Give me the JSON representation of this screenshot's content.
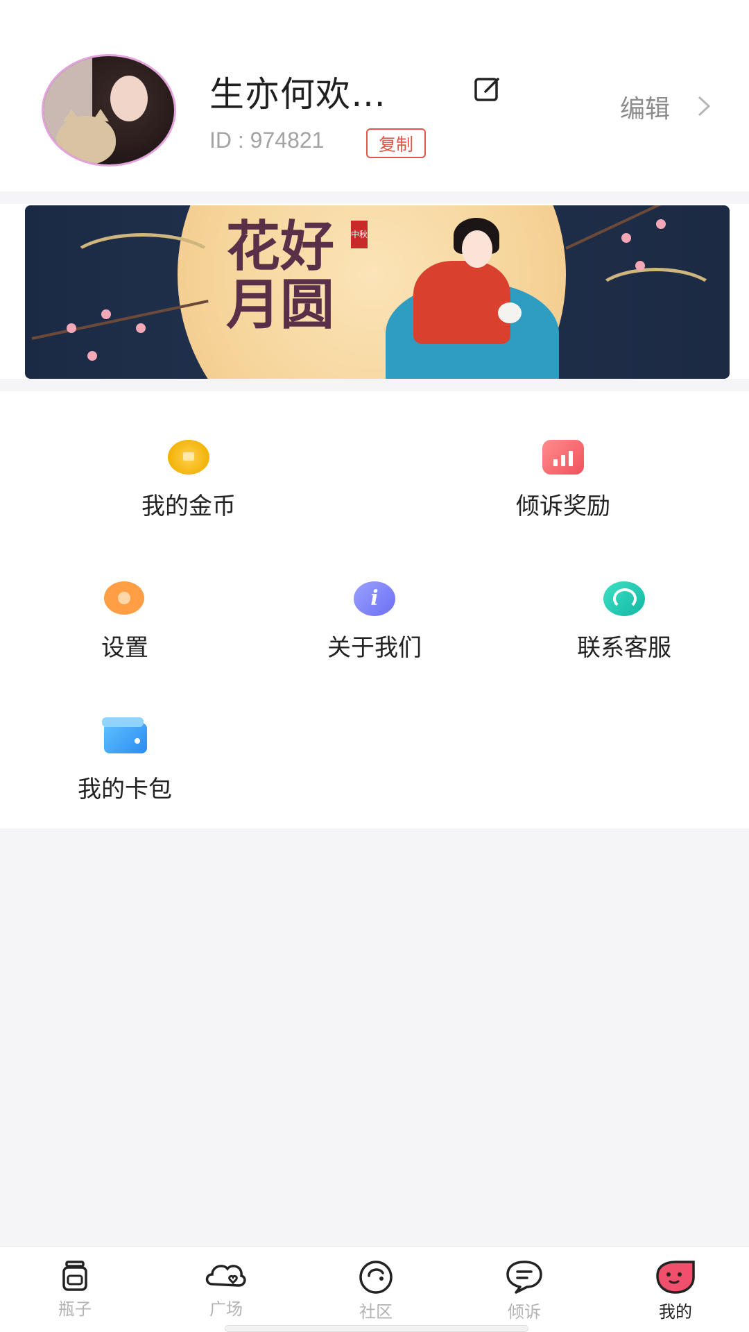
{
  "profile": {
    "nickname": "生亦何欢…",
    "id_text": "ID : 974821",
    "copy_label": "复制",
    "edit_label": "编辑"
  },
  "banner": {
    "title_line1": "花好",
    "title_line2": "月圆",
    "seal_text": "中秋"
  },
  "menu": {
    "items": [
      {
        "label": "我的金币",
        "icon": "coin-icon"
      },
      {
        "label": "倾诉奖励",
        "icon": "chart-icon"
      },
      {
        "label": "设置",
        "icon": "gear-icon"
      },
      {
        "label": "关于我们",
        "icon": "info-icon"
      },
      {
        "label": "联系客服",
        "icon": "headset-icon"
      },
      {
        "label": "我的卡包",
        "icon": "card-wallet-icon"
      }
    ]
  },
  "tabbar": {
    "tabs": [
      {
        "label": "瓶子",
        "icon": "bottle-icon",
        "active": false
      },
      {
        "label": "广场",
        "icon": "cloud-heart-icon",
        "active": false
      },
      {
        "label": "社区",
        "icon": "community-icon",
        "active": false
      },
      {
        "label": "倾诉",
        "icon": "chat-bubble-icon",
        "active": false
      },
      {
        "label": "我的",
        "icon": "mine-face-icon",
        "active": true
      }
    ]
  },
  "colors": {
    "accent": "#e0564a",
    "active_tab": "#222222",
    "inactive_tab": "#b3b3b3",
    "mine_icon": "#f0506b"
  }
}
